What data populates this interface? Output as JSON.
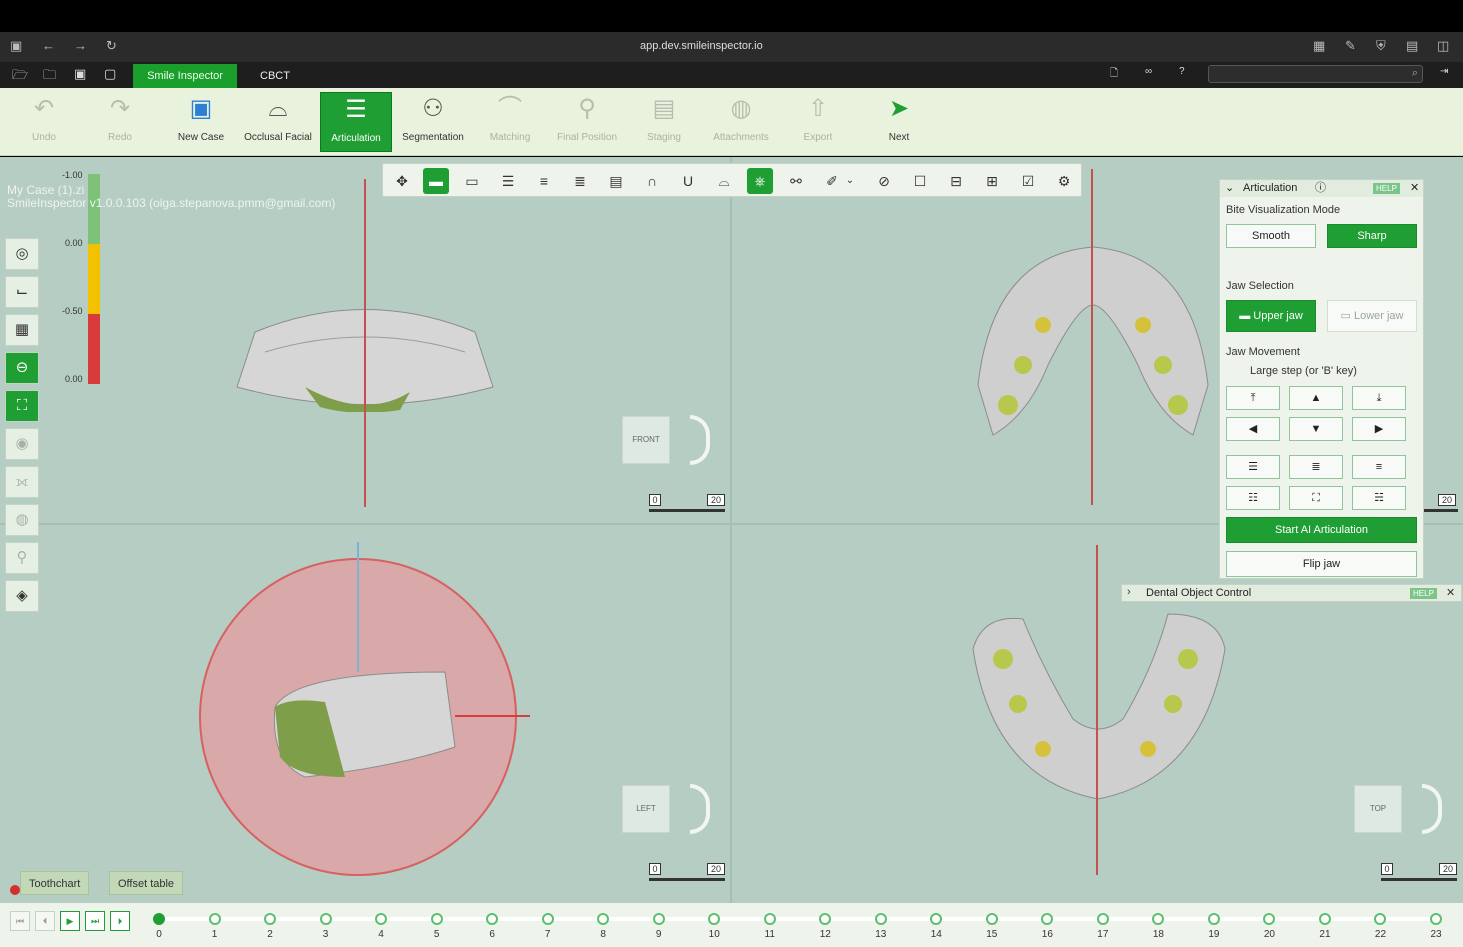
{
  "browser": {
    "url": "app.dev.smileinspector.io"
  },
  "appmenu": {
    "tabs": [
      "Smile Inspector",
      "CBCT"
    ]
  },
  "ribbon": {
    "buttons": [
      {
        "label": "Undo",
        "state": "disabled",
        "icon": "undo-icon"
      },
      {
        "label": "Redo",
        "state": "disabled",
        "icon": "redo-icon"
      },
      {
        "label": "New Case",
        "state": "normal",
        "icon": "new-case-icon"
      },
      {
        "label": "Occlusal Facial",
        "state": "normal",
        "icon": "occlusal-facial-icon"
      },
      {
        "label": "Articulation",
        "state": "active",
        "icon": "articulation-icon"
      },
      {
        "label": "Segmentation",
        "state": "normal",
        "icon": "segmentation-icon"
      },
      {
        "label": "Matching",
        "state": "disabled",
        "icon": "matching-icon"
      },
      {
        "label": "Final Position",
        "state": "disabled",
        "icon": "final-position-icon"
      },
      {
        "label": "Staging",
        "state": "disabled",
        "icon": "staging-icon"
      },
      {
        "label": "Attachments",
        "state": "disabled",
        "icon": "attachments-icon"
      },
      {
        "label": "Export",
        "state": "disabled",
        "icon": "export-icon"
      },
      {
        "label": "Next",
        "state": "normal",
        "icon": "next-icon"
      }
    ]
  },
  "caseinfo": {
    "line1": "My Case (1).zi",
    "line2": "SmileInspector v1.0.0.103 (olga.stepanova.pmm@gmail.com)"
  },
  "colorscale": {
    "labels": [
      "-1.00",
      "0.00",
      "-0.50",
      "0.00"
    ],
    "colors": [
      "#7ec27a",
      "#f2c200",
      "#d93a3a"
    ]
  },
  "views": [
    {
      "name": "FRONT"
    },
    {
      "name": "LEFT"
    },
    {
      "name": "TOP"
    }
  ],
  "scalebar": {
    "min": "0",
    "max": "20"
  },
  "articulation": {
    "title": "Articulation",
    "help": "HELP",
    "bite_mode_label": "Bite Visualization Mode",
    "smooth": "Smooth",
    "sharp": "Sharp",
    "jaw_selection_label": "Jaw Selection",
    "upper_jaw": "Upper jaw",
    "lower_jaw": "Lower jaw",
    "jaw_movement_label": "Jaw Movement",
    "step_label": "Large step (or 'B' key)",
    "start_ai": "Start AI Articulation",
    "flip_jaw": "Flip jaw"
  },
  "dental_panel": {
    "title": "Dental Object Control",
    "help": "HELP"
  },
  "bottom_tabs": [
    "Toothchart",
    "Offset table"
  ],
  "timeline": {
    "stages": [
      "0",
      "1",
      "2",
      "3",
      "4",
      "5",
      "6",
      "7",
      "8",
      "9",
      "10",
      "11",
      "12",
      "13",
      "14",
      "15",
      "16",
      "17",
      "18",
      "19",
      "20",
      "21",
      "22",
      "23"
    ],
    "current": 0
  }
}
